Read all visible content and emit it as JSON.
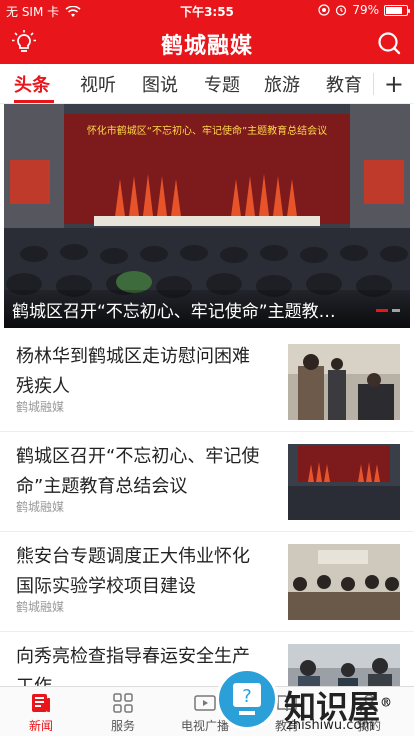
{
  "status_bar": {
    "carrier": "无 SIM 卡",
    "time": "下午3:55",
    "battery_text": "79%",
    "battery_level": 0.79
  },
  "header": {
    "title": "鹤城融媒",
    "left_icon": "bulb-icon",
    "right_icon": "search-icon"
  },
  "tabs": [
    {
      "label": "头条",
      "active": true
    },
    {
      "label": "视听"
    },
    {
      "label": "图说"
    },
    {
      "label": "专题"
    },
    {
      "label": "旅游"
    },
    {
      "label": "教育"
    }
  ],
  "tabs_more": "+",
  "hero": {
    "caption": "鹤城区召开“不忘初心、牢记使命”主题教…",
    "banner_text": "怀化市鹤城区“不忘初心、牢记使命”主题教育总结会议"
  },
  "news": [
    {
      "title": "杨林华到鹤城区走访慰问困难残疾人",
      "source": "鹤城融媒"
    },
    {
      "title": "鹤城区召开“不忘初心、牢记使命”主题教育总结会议",
      "source": "鹤城融媒"
    },
    {
      "title": "熊安台专题调度正大伟业怀化国际实验学校项目建设",
      "source": "鹤城融媒"
    },
    {
      "title": "向秀亮检查指导春运安全生产工作",
      "source": ""
    }
  ],
  "bottom_nav": [
    {
      "label": "新闻",
      "icon": "news-icon",
      "active": true
    },
    {
      "label": "服务",
      "icon": "grid-icon"
    },
    {
      "label": "电视广播",
      "icon": "tv-icon"
    },
    {
      "label": "教育",
      "icon": "book-icon"
    },
    {
      "label": "我的",
      "icon": "user-icon"
    }
  ],
  "watermark": {
    "text": "知识屋",
    "sub": "zhishiwu.com",
    "mark": "®"
  },
  "colors": {
    "brand_red": "#e8151b",
    "text": "#222222",
    "muted": "#999999"
  }
}
